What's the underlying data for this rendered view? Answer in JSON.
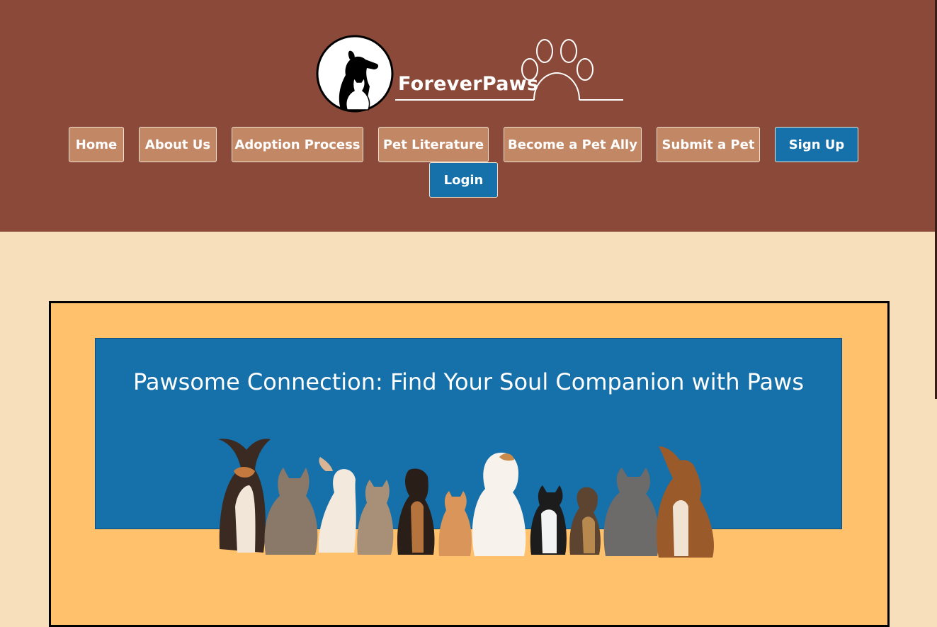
{
  "brand": {
    "name": "ForeverPaws"
  },
  "nav": {
    "items": [
      {
        "label": "Home"
      },
      {
        "label": "About Us"
      },
      {
        "label": "Adoption Process"
      },
      {
        "label": "Pet Literature"
      },
      {
        "label": "Become a Pet Ally"
      },
      {
        "label": "Submit a Pet"
      },
      {
        "label": "Sign Up"
      },
      {
        "label": "Login"
      }
    ]
  },
  "hero": {
    "title": "Pawsome Connection: Find Your Soul Companion with Paws"
  },
  "colors": {
    "header_bg": "#8b4a39",
    "page_bg": "#f8dfbb",
    "nav_button": "#c28866",
    "accent_blue": "#1670a9",
    "box_bg": "#ffc16b"
  },
  "icons": [
    "dog-cat-silhouette-logo",
    "paw-print-icon"
  ]
}
